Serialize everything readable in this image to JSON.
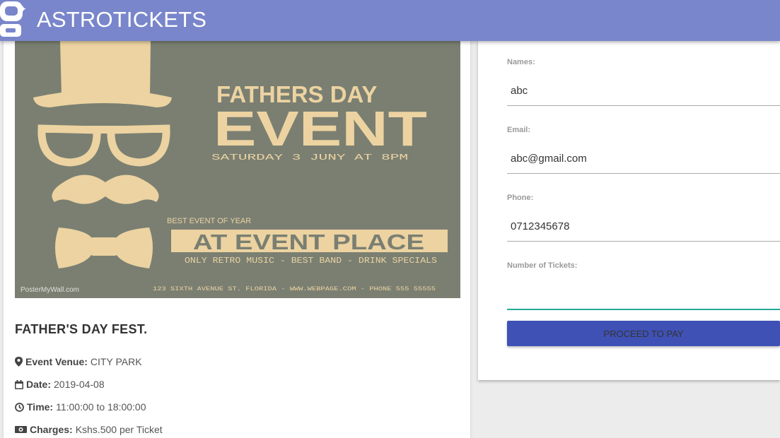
{
  "navbar": {
    "brand": "ASTROTICKETS",
    "logo_icon": "astronaut-logo-icon"
  },
  "poster": {
    "title_line1": "FATHERS DAY",
    "title_line2": "EVENT",
    "date_line": "SATURDAY 3 JUNY AT 8PM",
    "best_event": "BEST EVENT OF YEAR",
    "place": "AT EVENT PLACE",
    "features": "ONLY RETRO MUSIC - BEST BAND - DRINK SPECIALS",
    "address": "123 SIXTH AVENUE ST. FLORIDA - WWW.WEBPAGE.COM - PHONE 555 55555",
    "watermark": "PosterMyWall.com",
    "bg_color": "#7a7f72",
    "accent_color": "#ecd3a1"
  },
  "event": {
    "title": "FATHER'S DAY FEST.",
    "venue_label": "Event Venue:",
    "venue_value": "CITY PARK",
    "date_label": "Date:",
    "date_value": "2019-04-08",
    "time_label": "Time:",
    "time_value": "11:00:00 to 18:00:00",
    "charges_label": "Charges:",
    "charges_value": "Kshs.500 per Ticket"
  },
  "form": {
    "names_label": "Names:",
    "names_value": "abc",
    "email_label": "Email:",
    "email_value": "abc@gmail.com",
    "phone_label": "Phone:",
    "phone_value": "0712345678",
    "tickets_label": "Number of Tickets:",
    "tickets_value": "",
    "submit_label": "PROCEED TO PAY"
  },
  "colors": {
    "navbar": "#7986cb",
    "button": "#3f51b5",
    "input_focus": "#26a69a"
  }
}
